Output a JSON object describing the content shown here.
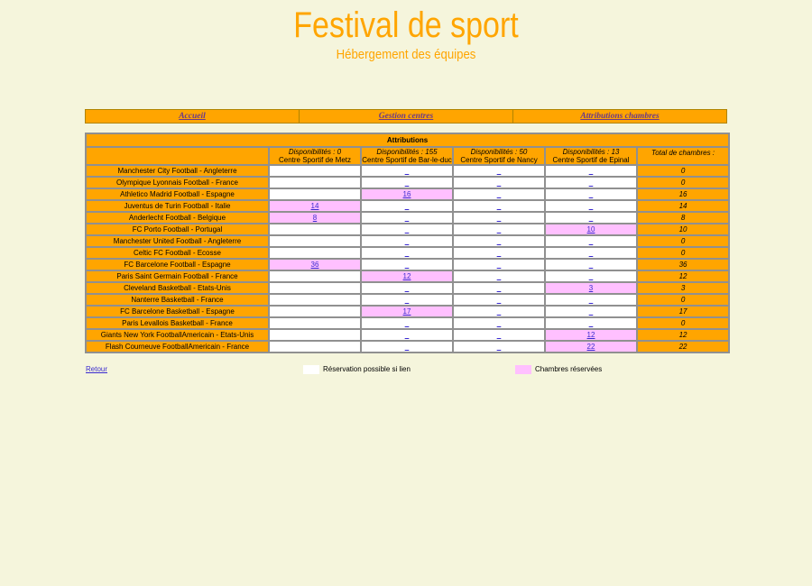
{
  "header": {
    "title": "Festival de sport",
    "subtitle": "Hébergement des équipes"
  },
  "menu": {
    "items": [
      "Accueil",
      "Gestion centres",
      "Attributions chambres"
    ]
  },
  "table": {
    "caption": "Attributions",
    "columns": [
      {
        "dispo": "Disponibilités : 0",
        "centre": "Centre Sportif de Metz"
      },
      {
        "dispo": "Disponibilités : 155",
        "centre": "Centre Sportif de Bar-le-duc"
      },
      {
        "dispo": "Disponibilités : 50",
        "centre": "Centre Sportif de Nancy"
      },
      {
        "dispo": "Disponibilités : 13",
        "centre": "Centre Sportif de Epinal"
      }
    ],
    "total_header": "Total de chambres :",
    "rows": [
      {
        "team": "Manchester City Football - Angleterre",
        "cells": [
          "",
          "_",
          "_",
          "_"
        ],
        "total": "0"
      },
      {
        "team": "Olympique Lyonnais Football - France",
        "cells": [
          "",
          "_",
          "_",
          "_"
        ],
        "total": "0"
      },
      {
        "team": "Athletico Madrid Football - Espagne",
        "cells": [
          "",
          "16",
          "_",
          "_"
        ],
        "total": "16"
      },
      {
        "team": "Juventus de Turin Football - Italie",
        "cells": [
          "14",
          "_",
          "_",
          "_"
        ],
        "total": "14"
      },
      {
        "team": "Anderlecht Football - Belgique",
        "cells": [
          "8",
          "_",
          "_",
          "_"
        ],
        "total": "8"
      },
      {
        "team": "FC Porto Football - Portugal",
        "cells": [
          "",
          "_",
          "_",
          "10"
        ],
        "total": "10"
      },
      {
        "team": "Manchester United Football - Angleterre",
        "cells": [
          "",
          "_",
          "_",
          "_"
        ],
        "total": "0"
      },
      {
        "team": "Celtic FC Football - Ecosse",
        "cells": [
          "",
          "_",
          "_",
          "_"
        ],
        "total": "0"
      },
      {
        "team": "FC Barcelone Football - Espagne",
        "cells": [
          "36",
          "_",
          "_",
          "_"
        ],
        "total": "36"
      },
      {
        "team": "Paris Saint Germain Football - France",
        "cells": [
          "",
          "12",
          "_",
          "_"
        ],
        "total": "12"
      },
      {
        "team": "Cleveland Basketball - Etats-Unis",
        "cells": [
          "",
          "_",
          "_",
          "3"
        ],
        "total": "3"
      },
      {
        "team": "Nanterre Basketball - France",
        "cells": [
          "",
          "_",
          "_",
          "_"
        ],
        "total": "0"
      },
      {
        "team": "FC Barcelone Basketball - Espagne",
        "cells": [
          "",
          "17",
          "_",
          "_"
        ],
        "total": "17"
      },
      {
        "team": "Paris Levallois Basketball - France",
        "cells": [
          "",
          "_",
          "_",
          "_"
        ],
        "total": "0"
      },
      {
        "team": "Giants New York FootballAmericain - Etats-Unis",
        "cells": [
          "",
          "_",
          "_",
          "12"
        ],
        "total": "12"
      },
      {
        "team": "Flash Courneuve FootballAmericain - France",
        "cells": [
          "",
          "_",
          "_",
          "22"
        ],
        "total": "22"
      }
    ]
  },
  "footer": {
    "retour": "Retour",
    "legend_white": "Réservation possible si lien",
    "legend_pink": "Chambres réservées"
  },
  "colors": {
    "background": "#f5f5dc",
    "accent": "#ffa500",
    "reserved": "#ffc0ff",
    "available": "#ffffff"
  }
}
